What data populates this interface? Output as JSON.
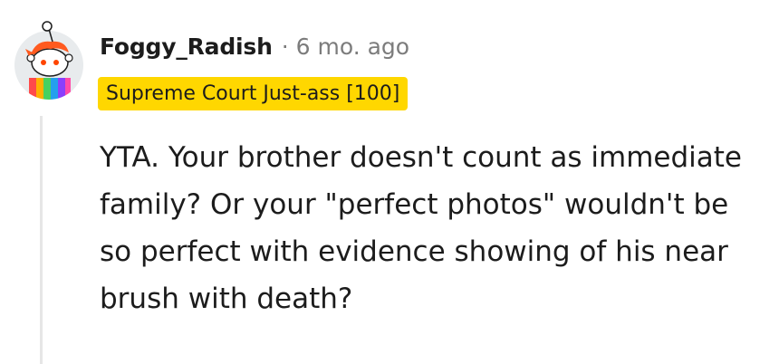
{
  "comment": {
    "author": "Foggy_Radish",
    "separator": "·",
    "timestamp": "6 mo. ago",
    "flair": "Supreme Court Just-ass [100]",
    "body": "YTA. Your brother doesn't count as immediate family? Or your \"perfect photos\" wouldn't be so perfect with evidence showing of his near brush with death?",
    "avatar_icon": "snoo-avatar-icon"
  },
  "colors": {
    "flair_background": "#ffd700",
    "text": "#1c1c1c",
    "muted": "#7c7c7c",
    "thread_line": "#e6e6e6"
  }
}
